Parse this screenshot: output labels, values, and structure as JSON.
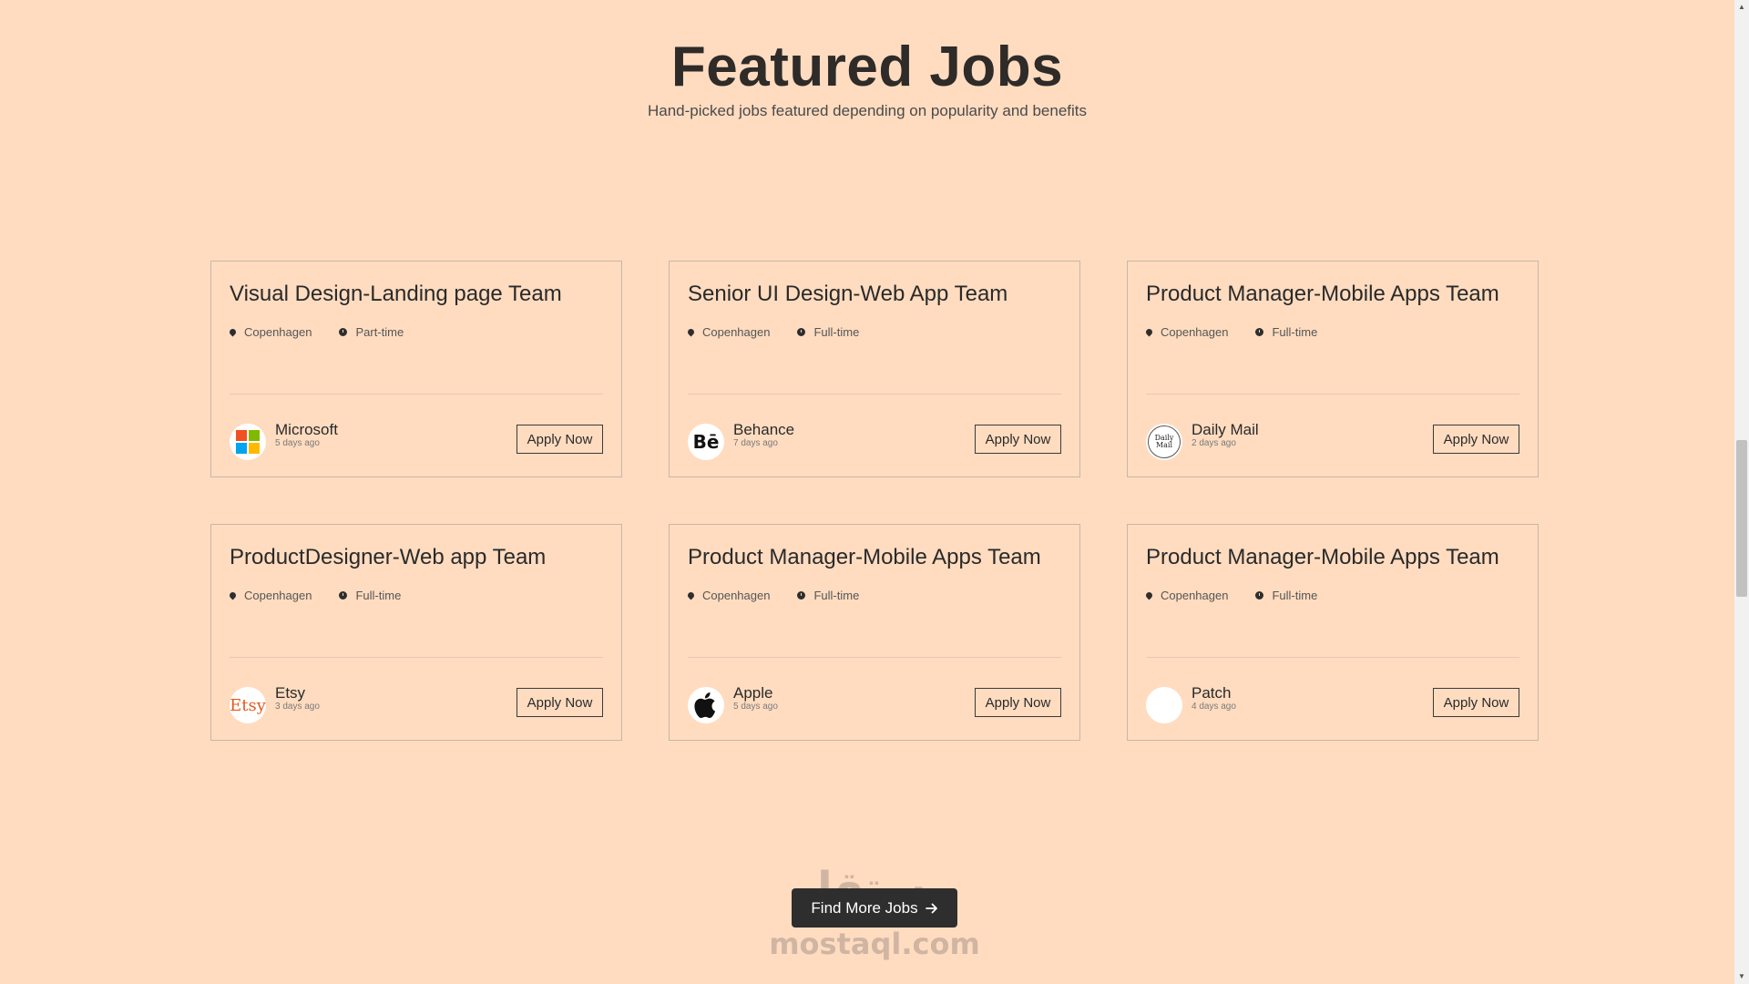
{
  "header": {
    "title": "Featured Jobs",
    "subtitle": "Hand-picked jobs featured depending on popularity and benefits"
  },
  "colors": {
    "background": "#ffdcc0",
    "text": "#2e2b29",
    "button_dark": "#2e2e2e",
    "microsoft": [
      "#f25022",
      "#7fba00",
      "#00a4ef",
      "#ffb900"
    ],
    "etsy": "#e45a1e"
  },
  "jobs": [
    {
      "title": "Visual Design-Landing page Team",
      "location": "Copenhagen",
      "type": "Part-time",
      "company": "Microsoft",
      "posted": "5 days ago",
      "logo_icon": "microsoft-logo-icon",
      "apply_label": "Apply Now"
    },
    {
      "title": "Senior UI Design-Web App Team",
      "location": "Copenhagen",
      "type": "Full-time",
      "company": "Behance",
      "posted": "7 days ago",
      "logo_icon": "behance-logo-icon",
      "logo_text": "Bē",
      "apply_label": "Apply Now"
    },
    {
      "title": "Product Manager-Mobile Apps Team",
      "location": "Copenhagen",
      "type": "Full-time",
      "company": "Daily Mail",
      "posted": "2 days ago",
      "logo_icon": "daily-mail-logo-icon",
      "logo_text": "Daily Mail",
      "apply_label": "Apply Now"
    },
    {
      "title": "ProductDesigner-Web app Team",
      "location": "Copenhagen",
      "type": "Full-time",
      "company": "Etsy",
      "posted": "3 days ago",
      "logo_icon": "etsy-logo-icon",
      "logo_text": "Etsy",
      "apply_label": "Apply Now"
    },
    {
      "title": "Product Manager-Mobile Apps Team",
      "location": "Copenhagen",
      "type": "Full-time",
      "company": "Apple",
      "posted": "5 days ago",
      "logo_icon": "apple-logo-icon",
      "apply_label": "Apply Now"
    },
    {
      "title": "Product Manager-Mobile Apps Team",
      "location": "Copenhagen",
      "type": "Full-time",
      "company": "Patch",
      "posted": "4 days ago",
      "logo_icon": "patch-logo-icon",
      "apply_label": "Apply Now"
    }
  ],
  "find_more": {
    "label": "Find More Jobs",
    "icon": "arrow-right-icon"
  },
  "watermark": {
    "arabic": "مستقل",
    "latin": "mostaql.com"
  }
}
